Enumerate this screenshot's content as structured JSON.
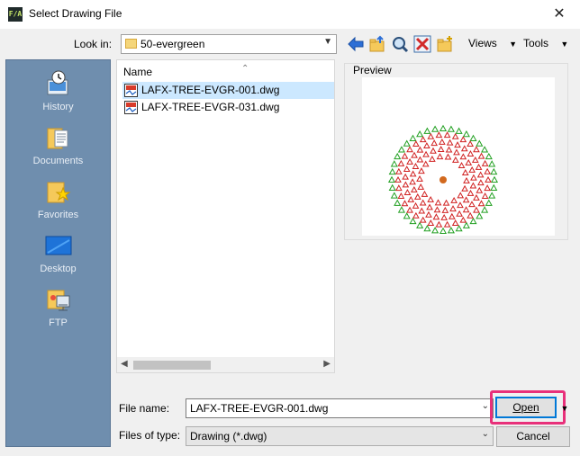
{
  "window": {
    "title": "Select Drawing File",
    "close_glyph": "✕"
  },
  "lookin": {
    "label": "Look in:",
    "value": "50-evergreen"
  },
  "toolbar": {
    "views_label": "Views",
    "tools_label": "Tools"
  },
  "places": [
    {
      "label": "History",
      "icon": "history-icon"
    },
    {
      "label": "Documents",
      "icon": "documents-icon"
    },
    {
      "label": "Favorites",
      "icon": "favorites-icon"
    },
    {
      "label": "Desktop",
      "icon": "desktop-icon"
    },
    {
      "label": "FTP",
      "icon": "ftp-icon"
    }
  ],
  "filelist": {
    "column_header": "Name",
    "files": [
      {
        "name": "LAFX-TREE-EVGR-001.dwg",
        "selected": true
      },
      {
        "name": "LAFX-TREE-EVGR-031.dwg",
        "selected": false
      }
    ]
  },
  "preview": {
    "label": "Preview"
  },
  "filename": {
    "label": "File name:",
    "value": "LAFX-TREE-EVGR-001.dwg"
  },
  "filetype": {
    "label": "Files of type:",
    "value": "Drawing (*.dwg)"
  },
  "buttons": {
    "open": "Open",
    "cancel": "Cancel"
  },
  "colors": {
    "places_bg": "#6f8eae",
    "highlight": "#e8307a",
    "selection": "#cce8ff"
  }
}
